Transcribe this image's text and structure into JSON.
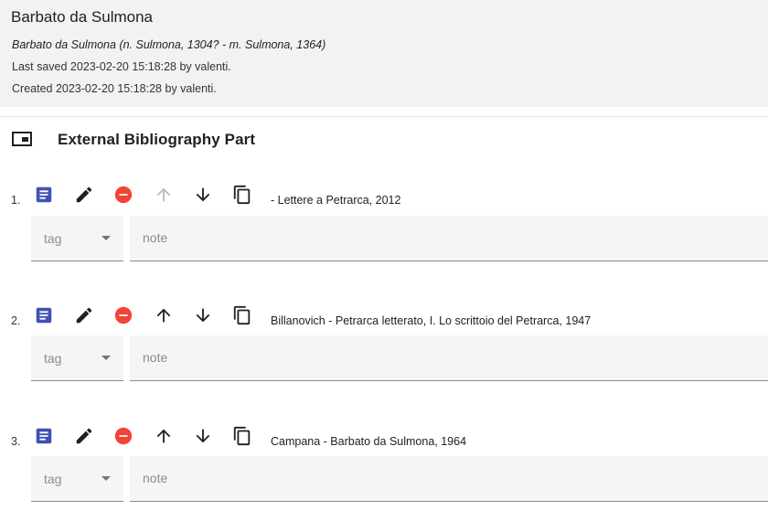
{
  "header": {
    "title": "Barbato da Sulmona",
    "subtitle": "Barbato da Sulmona (n. Sulmona, 1304? - m. Sulmona, 1364)",
    "last_saved": "Last saved 2023-02-20 15:18:28 by valenti.",
    "created": "Created 2023-02-20 15:18:28 by valenti."
  },
  "part": {
    "title": "External Bibliography Part",
    "icon": "picture-in-picture-icon"
  },
  "entries": [
    {
      "number": "1.",
      "text": "- Lettere a Petrarca, 2012",
      "tag_label": "tag",
      "note_placeholder": "note",
      "move_up_enabled": false
    },
    {
      "number": "2.",
      "text": "Billanovich - Petrarca letterato, I. Lo scrittoio del Petrarca, 1947",
      "tag_label": "tag",
      "note_placeholder": "note",
      "move_up_enabled": true
    },
    {
      "number": "3.",
      "text": "Campana - Barbato da Sulmona, 1964",
      "tag_label": "tag",
      "note_placeholder": "note",
      "move_up_enabled": true
    }
  ],
  "colors": {
    "header_bg": "#f2f2f2",
    "view_icon": "#3f51b5",
    "delete_icon": "#f44336",
    "icon_dark": "#212121",
    "icon_disabled": "#bdbdbd",
    "field_bg": "#f5f5f5"
  },
  "icons": [
    "description-icon",
    "edit-pencil-icon",
    "remove-circle-icon",
    "arrow-up-icon",
    "arrow-down-icon",
    "copy-icon"
  ]
}
